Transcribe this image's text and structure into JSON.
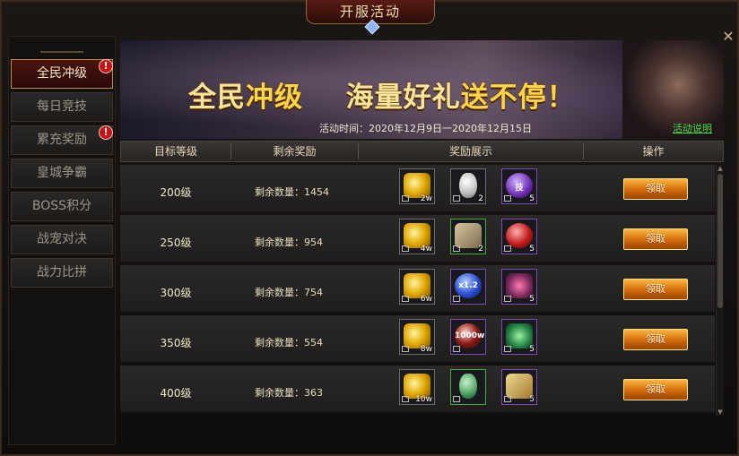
{
  "window": {
    "title": "开服活动"
  },
  "sidebar": {
    "items": [
      {
        "label": "全民冲级",
        "active": true,
        "badge": "!"
      },
      {
        "label": "每日竞技"
      },
      {
        "label": "累充奖励",
        "badge": "!"
      },
      {
        "label": "皇城争霸"
      },
      {
        "label": "BOSS积分"
      },
      {
        "label": "战宠对决"
      },
      {
        "label": "战力比拼"
      }
    ]
  },
  "banner": {
    "title_a": "全民",
    "title_b": "冲级",
    "title_c": "海量好礼",
    "title_d": "送不停！",
    "event_time": "活动时间：2020年12月9日一2020年12月15日",
    "event_desc_link": "活动说明"
  },
  "table": {
    "headers": {
      "level": "目标等级",
      "remaining": "剩余奖励",
      "rewards": "奖励展示",
      "action": "操作"
    },
    "rows": [
      {
        "level": "200级",
        "remaining": "剩余数量：1454",
        "rewards": [
          {
            "icon": "gold-coins-icon",
            "count": "2w"
          },
          {
            "icon": "white-egg-icon",
            "count": "2"
          },
          {
            "icon": "purple-orb-icon",
            "label": "技",
            "count": "5"
          }
        ],
        "button": "领取"
      },
      {
        "level": "250级",
        "remaining": "剩余数量：954",
        "rewards": [
          {
            "icon": "gold-coins-icon",
            "count": "4w"
          },
          {
            "icon": "skill-book-icon",
            "count": "2"
          },
          {
            "icon": "red-orb-icon",
            "count": "5"
          }
        ],
        "button": "领取"
      },
      {
        "level": "300级",
        "remaining": "剩余数量：754",
        "rewards": [
          {
            "icon": "gold-coins-icon",
            "count": "6w"
          },
          {
            "icon": "blue-orb-icon",
            "label": "x1.2",
            "count": ""
          },
          {
            "icon": "claw-icon",
            "count": "5"
          }
        ],
        "button": "领取"
      },
      {
        "level": "350级",
        "remaining": "剩余数量：554",
        "rewards": [
          {
            "icon": "gold-coins-icon",
            "count": "8w"
          },
          {
            "icon": "dark-orb-icon",
            "label": "1000w",
            "count": ""
          },
          {
            "icon": "green-leaf-icon",
            "count": "5"
          }
        ],
        "button": "领取"
      },
      {
        "level": "400级",
        "remaining": "剩余数量：363",
        "rewards": [
          {
            "icon": "gold-coins-icon",
            "count": "10w"
          },
          {
            "icon": "green-egg-icon",
            "count": ""
          },
          {
            "icon": "scroll-icon",
            "count": "5"
          }
        ],
        "button": "领取"
      }
    ]
  },
  "colors": {
    "accent_gold": "#ffd54a",
    "button_orange": "#d06a08",
    "link_green": "#4ee04a",
    "badge_red": "#c81414"
  }
}
